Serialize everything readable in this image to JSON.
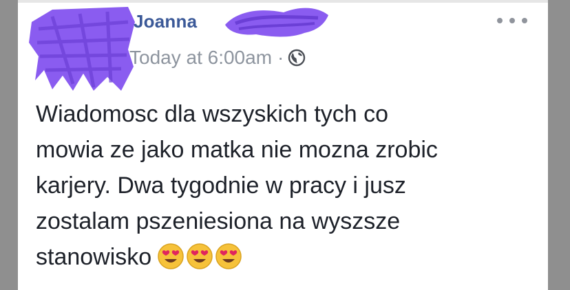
{
  "post": {
    "author_name": "Joanna",
    "timestamp": "Today at 6:00am",
    "separator": "·",
    "privacy_icon": "globe-icon",
    "more_icon": "more-options-icon",
    "text_lines": [
      "Wiadomosc dla wszyskich tych co",
      "mowia ze jako matka nie mozna zrobic",
      "karjery. Dwa tygodnie w pracy i jusz",
      "zostalam pszeniesiona na wyszsze",
      "stanowisko"
    ],
    "emojis": [
      "heart-eyes-emoji",
      "heart-eyes-emoji",
      "heart-eyes-emoji"
    ]
  },
  "colors": {
    "author_link": "#3b5998",
    "meta_text": "#8d949e",
    "body_text": "#1d2129",
    "redaction": "#8a5cf0",
    "emoji_face": "#f6c23a"
  }
}
